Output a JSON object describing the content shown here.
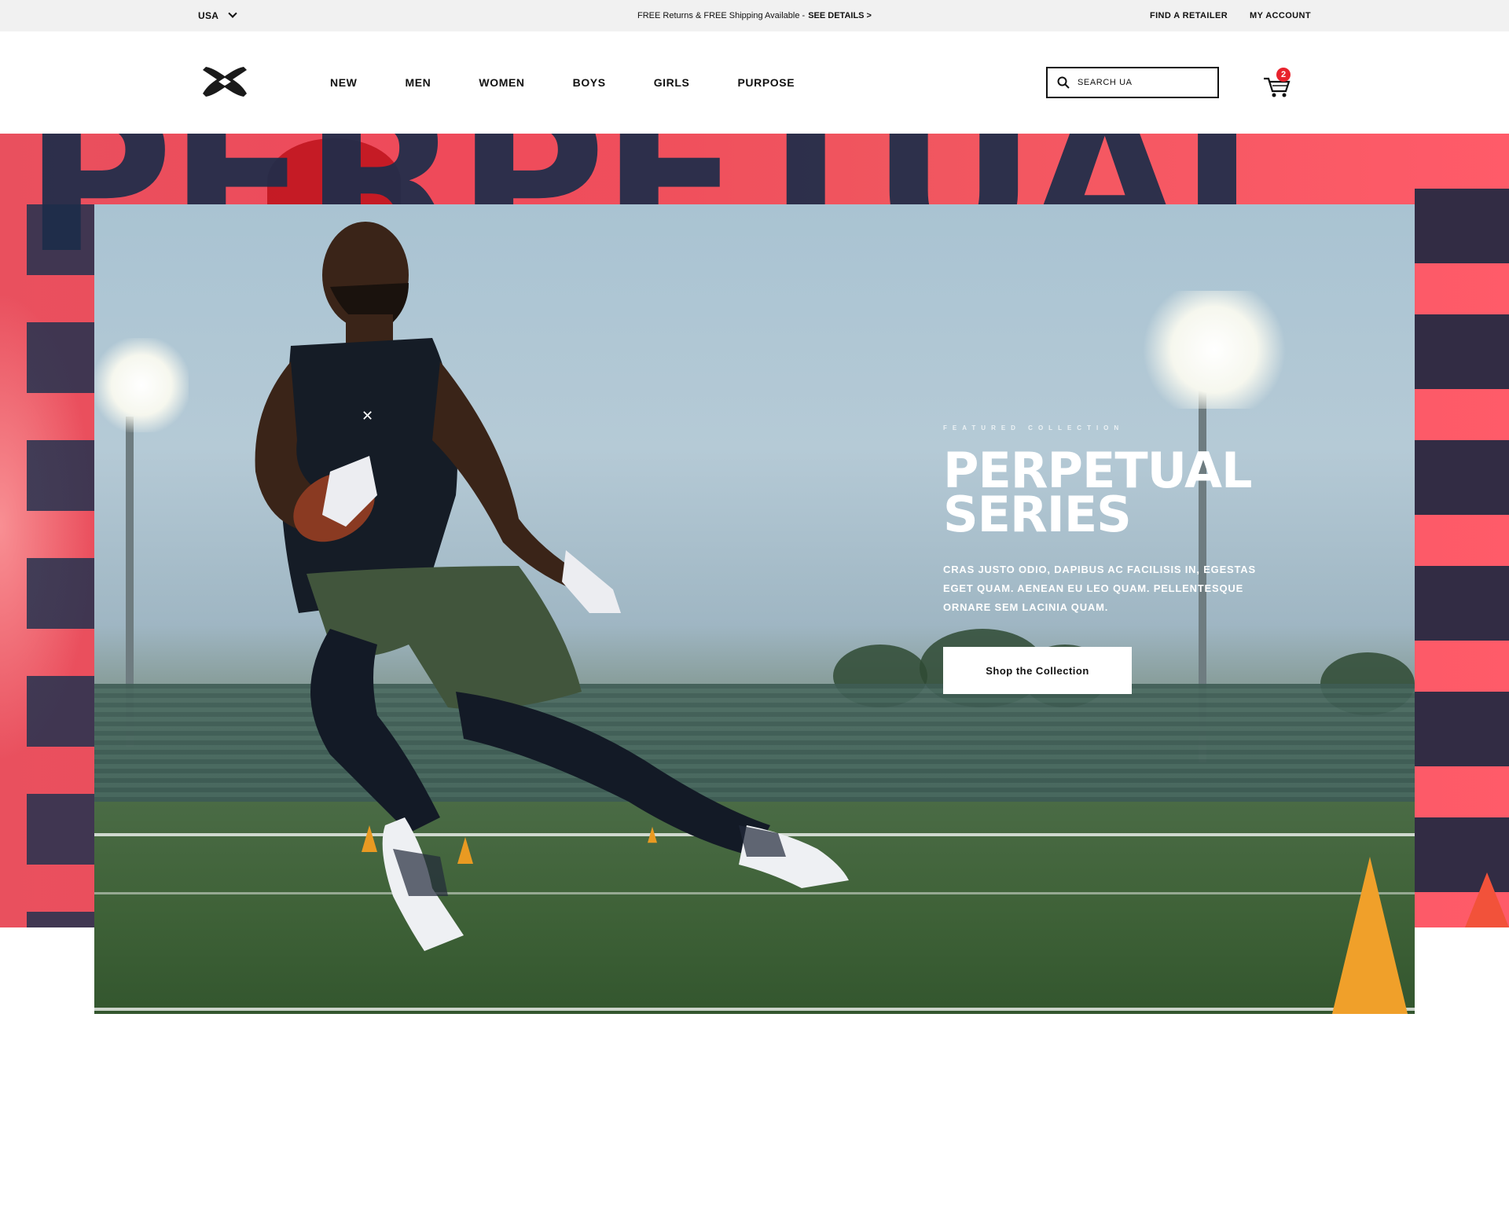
{
  "utility_bar": {
    "locale": "USA",
    "promo_text": "FREE Returns & FREE Shipping Available - ",
    "promo_link": "SEE DETAILS >",
    "find_retailer": "FIND A RETAILER",
    "my_account": "MY ACCOUNT"
  },
  "header": {
    "nav": [
      "NEW",
      "MEN",
      "WOMEN",
      "BOYS",
      "GIRLS",
      "PURPOSE"
    ],
    "search_placeholder": "SEARCH UA",
    "cart_count": "2"
  },
  "hero": {
    "background_word": "PERPETUAL",
    "eyebrow": "FEATURED COLLECTION",
    "title_line1": "PERPETUAL",
    "title_line2": "SERIES",
    "body": "CRAS JUSTO ODIO, DAPIBUS AC FACILISIS IN, EGESTAS EGET QUAM. AENEAN EU LEO QUAM. PELLENTESQUE ORNARE SEM LACINIA QUAM.",
    "cta": "Shop the Collection"
  },
  "colors": {
    "accent_red": "#e8232d",
    "hero_pink": "#ef4a5a",
    "hero_navy": "#1d2d4a"
  },
  "icons": {
    "logo": "under-armour-logo",
    "search": "search-icon",
    "cart": "cart-icon",
    "chevron": "chevron-down-icon"
  }
}
